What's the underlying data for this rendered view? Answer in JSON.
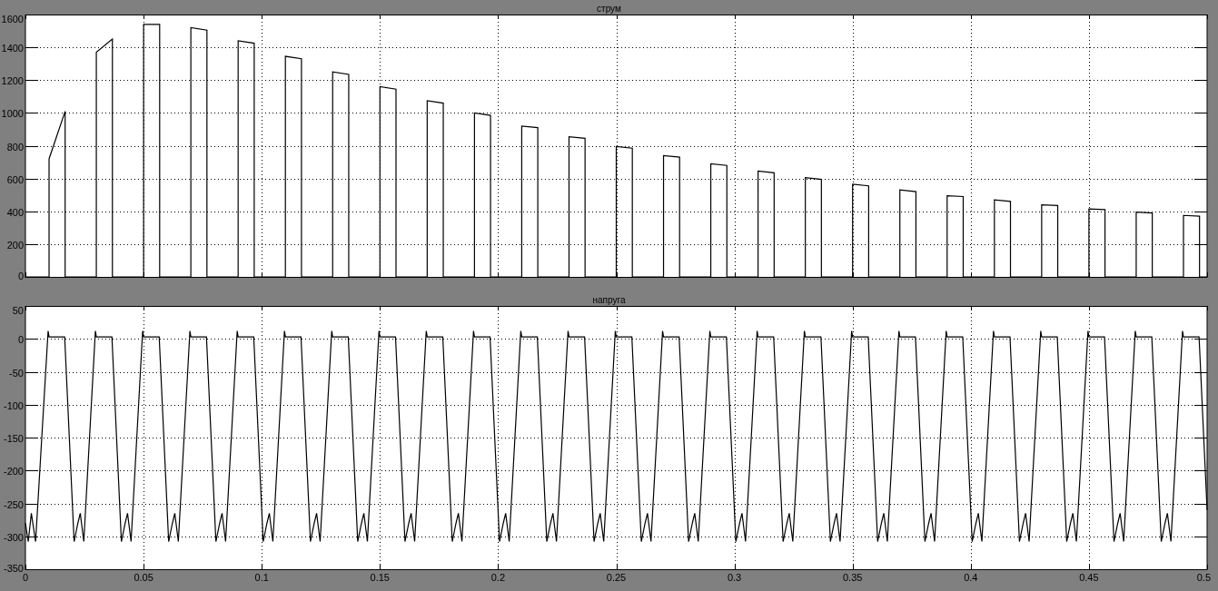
{
  "plots": [
    {
      "chart_data": {
        "type": "line",
        "grid": true,
        "title": "струм",
        "xlim": [
          0,
          0.5
        ],
        "ylim": [
          0,
          1600
        ],
        "yticks": [
          0,
          200,
          400,
          600,
          800,
          1000,
          1200,
          1400,
          1600
        ],
        "x": [
          0,
          0.01,
          0.01,
          0.0168,
          0.0168,
          0.03,
          0.03,
          0.0368,
          0.0368,
          0.05,
          0.05,
          0.0568,
          0.0568,
          0.07,
          0.07,
          0.0768,
          0.0768,
          0.09,
          0.09,
          0.0968,
          0.0968,
          0.11,
          0.11,
          0.1168,
          0.1168,
          0.13,
          0.13,
          0.1368,
          0.1368,
          0.15,
          0.15,
          0.1568,
          0.1568,
          0.17,
          0.17,
          0.1768,
          0.1768,
          0.19,
          0.19,
          0.1968,
          0.1968,
          0.21,
          0.21,
          0.2168,
          0.2168,
          0.23,
          0.23,
          0.2368,
          0.2368,
          0.25,
          0.25,
          0.2568,
          0.2568,
          0.27,
          0.27,
          0.2768,
          0.2768,
          0.29,
          0.29,
          0.2968,
          0.2968,
          0.31,
          0.31,
          0.3168,
          0.3168,
          0.33,
          0.33,
          0.3368,
          0.3368,
          0.35,
          0.35,
          0.3568,
          0.3568,
          0.37,
          0.37,
          0.3768,
          0.3768,
          0.39,
          0.39,
          0.3968,
          0.3968,
          0.41,
          0.41,
          0.4168,
          0.4168,
          0.43,
          0.43,
          0.4368,
          0.4368,
          0.45,
          0.45,
          0.4568,
          0.4568,
          0.47,
          0.47,
          0.4768,
          0.4768,
          0.49,
          0.49,
          0.4968,
          0.4968,
          0.5
        ],
        "series": [
          {
            "color": "#000000",
            "values": [
              0,
              0,
              720,
              1010,
              0,
              0,
              1370,
              1450,
              0,
              0,
              1540,
              1540,
              0,
              0,
              1520,
              1505,
              0,
              0,
              1440,
              1425,
              0,
              0,
              1345,
              1330,
              0,
              0,
              1250,
              1235,
              0,
              0,
              1160,
              1145,
              0,
              0,
              1075,
              1060,
              0,
              0,
              1000,
              985,
              0,
              0,
              920,
              910,
              0,
              0,
              855,
              845,
              0,
              0,
              795,
              785,
              0,
              0,
              740,
              730,
              0,
              0,
              690,
              680,
              0,
              0,
              645,
              635,
              0,
              0,
              605,
              595,
              0,
              0,
              565,
              555,
              0,
              0,
              530,
              520,
              0,
              0,
              495,
              490,
              0,
              0,
              470,
              460,
              0,
              0,
              440,
              435,
              0,
              0,
              415,
              410,
              0,
              0,
              395,
              390,
              0,
              0,
              375,
              370,
              0,
              0
            ]
          }
        ]
      }
    },
    {
      "chart_data": {
        "type": "line",
        "grid": true,
        "title": "напруга",
        "xlim": [
          0,
          0.5
        ],
        "ylim": [
          -350,
          50
        ],
        "yticks": [
          -350,
          -300,
          -250,
          -200,
          -150,
          -100,
          -50,
          0,
          50
        ],
        "xticks": [
          0,
          0.05,
          0.1,
          0.15,
          0.2,
          0.25,
          0.3,
          0.35,
          0.4,
          0.45,
          0.5
        ],
        "x": [
          0,
          0.0012,
          0.0025,
          0.0043,
          0.0096,
          0.01,
          0.0166,
          0.0206,
          0.0222,
          0.0232,
          0.0247,
          0.0296,
          0.03,
          0.0366,
          0.0406,
          0.0422,
          0.0432,
          0.0447,
          0.0496,
          0.05,
          0.0566,
          0.0606,
          0.0622,
          0.0632,
          0.0647,
          0.0696,
          0.07,
          0.0766,
          0.0806,
          0.0822,
          0.0832,
          0.0847,
          0.0896,
          0.09,
          0.0966,
          0.1006,
          0.1022,
          0.1032,
          0.1047,
          0.1096,
          0.11,
          0.1166,
          0.1206,
          0.1222,
          0.1232,
          0.1247,
          0.1296,
          0.13,
          0.1366,
          0.1406,
          0.1422,
          0.1432,
          0.1447,
          0.1496,
          0.15,
          0.1566,
          0.1606,
          0.1622,
          0.1632,
          0.1647,
          0.1696,
          0.17,
          0.1766,
          0.1806,
          0.1822,
          0.1832,
          0.1847,
          0.1896,
          0.19,
          0.1966,
          0.2006,
          0.2022,
          0.2032,
          0.2047,
          0.2096,
          0.21,
          0.2166,
          0.2206,
          0.2222,
          0.2232,
          0.2247,
          0.2296,
          0.23,
          0.2366,
          0.2406,
          0.2422,
          0.2432,
          0.2447,
          0.2496,
          0.25,
          0.2566,
          0.2606,
          0.2622,
          0.2632,
          0.2647,
          0.2696,
          0.27,
          0.2766,
          0.2806,
          0.2822,
          0.2832,
          0.2847,
          0.2896,
          0.29,
          0.2966,
          0.3006,
          0.3022,
          0.3032,
          0.3047,
          0.3096,
          0.31,
          0.3166,
          0.3206,
          0.3222,
          0.3232,
          0.3247,
          0.3296,
          0.33,
          0.3366,
          0.3406,
          0.3422,
          0.3432,
          0.3447,
          0.3496,
          0.35,
          0.3566,
          0.3606,
          0.3622,
          0.3632,
          0.3647,
          0.3696,
          0.37,
          0.3766,
          0.3806,
          0.3822,
          0.3832,
          0.3847,
          0.3896,
          0.39,
          0.3966,
          0.4006,
          0.4022,
          0.4032,
          0.4047,
          0.4096,
          0.41,
          0.4166,
          0.4206,
          0.4222,
          0.4232,
          0.4247,
          0.4296,
          0.43,
          0.4366,
          0.4406,
          0.4422,
          0.4432,
          0.4447,
          0.4496,
          0.45,
          0.4566,
          0.4606,
          0.4622,
          0.4632,
          0.4647,
          0.4696,
          0.47,
          0.4766,
          0.4806,
          0.4822,
          0.4832,
          0.4847,
          0.4896,
          0.49,
          0.4966,
          0.5
        ],
        "series": [
          {
            "color": "#000000",
            "values": [
              -280,
              -308,
              -265,
              -308,
              12,
              3,
              3,
              -308,
              -280,
              -265,
              -308,
              12,
              3,
              3,
              -308,
              -280,
              -265,
              -308,
              12,
              3,
              3,
              -308,
              -280,
              -265,
              -308,
              12,
              3,
              3,
              -308,
              -280,
              -265,
              -308,
              12,
              3,
              3,
              -308,
              -280,
              -265,
              -308,
              12,
              3,
              3,
              -308,
              -280,
              -265,
              -308,
              12,
              3,
              3,
              -308,
              -280,
              -265,
              -308,
              12,
              3,
              3,
              -308,
              -280,
              -265,
              -308,
              12,
              3,
              3,
              -308,
              -280,
              -265,
              -308,
              12,
              3,
              3,
              -308,
              -280,
              -265,
              -308,
              12,
              3,
              3,
              -308,
              -280,
              -265,
              -308,
              12,
              3,
              3,
              -308,
              -280,
              -265,
              -308,
              12,
              3,
              3,
              -308,
              -280,
              -265,
              -308,
              12,
              3,
              3,
              -308,
              -280,
              -265,
              -308,
              12,
              3,
              3,
              -308,
              -280,
              -265,
              -308,
              12,
              3,
              3,
              -308,
              -280,
              -265,
              -308,
              12,
              3,
              3,
              -308,
              -280,
              -265,
              -308,
              12,
              3,
              3,
              -308,
              -280,
              -265,
              -308,
              12,
              3,
              3,
              -308,
              -280,
              -265,
              -308,
              12,
              3,
              3,
              -308,
              -280,
              -265,
              -308,
              12,
              3,
              3,
              -308,
              -280,
              -265,
              -308,
              12,
              3,
              3,
              -308,
              -280,
              -265,
              -308,
              12,
              3,
              3,
              -308,
              -280,
              -265,
              -308,
              12,
              3,
              3,
              -308,
              -280,
              -265,
              -308,
              12,
              3,
              3,
              -260
            ]
          }
        ]
      }
    }
  ]
}
